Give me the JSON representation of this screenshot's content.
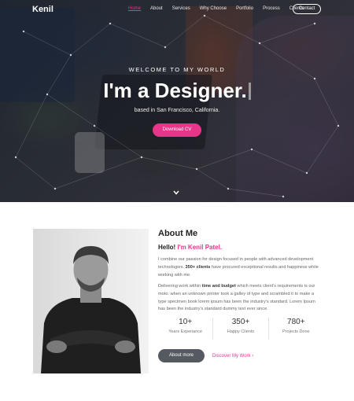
{
  "nav": {
    "logo": "Kenil",
    "links": [
      "Home",
      "About",
      "Services",
      "Why Choose",
      "Portfolio",
      "Process",
      "Clients"
    ],
    "active_index": 0,
    "contact_label": "Contact"
  },
  "hero": {
    "welcome": "WELCOME TO MY WORLD",
    "headline": "I'm a Designer.",
    "subtitle": "based in San Francisco, California.",
    "cta_label": "Download CV",
    "scroll_icon": "chevron-down-icon"
  },
  "about": {
    "title": "About Me",
    "hello_prefix": "Hello!",
    "hello_name": "I'm Kenil Patel.",
    "para1_a": "I combine our passion for design focused in people with advanced development technologies.",
    "para1_bold": "350+ clients",
    "para1_b": "have procured exceptional results and happiness while working with me.",
    "para2_a": "Delivering work within",
    "para2_bold": "time and budget",
    "para2_b": "which meets client's requirements is our moto. when an unknown printer took a galley of type and scrambled it to make a type specimen book lorem ipsum has been the industry's standard. Lorem Ipsum has been the industry's standard dummy text ever since.",
    "stats": [
      {
        "value": "10+",
        "label": "Years Experiance"
      },
      {
        "value": "350+",
        "label": "Happy Clients"
      },
      {
        "value": "780+",
        "label": "Projects Done"
      }
    ],
    "about_button": "About more",
    "work_link": "Discover My Work",
    "work_link_arrow": "›"
  },
  "colors": {
    "accent": "#e8358a",
    "dark_button": "#555a60"
  }
}
